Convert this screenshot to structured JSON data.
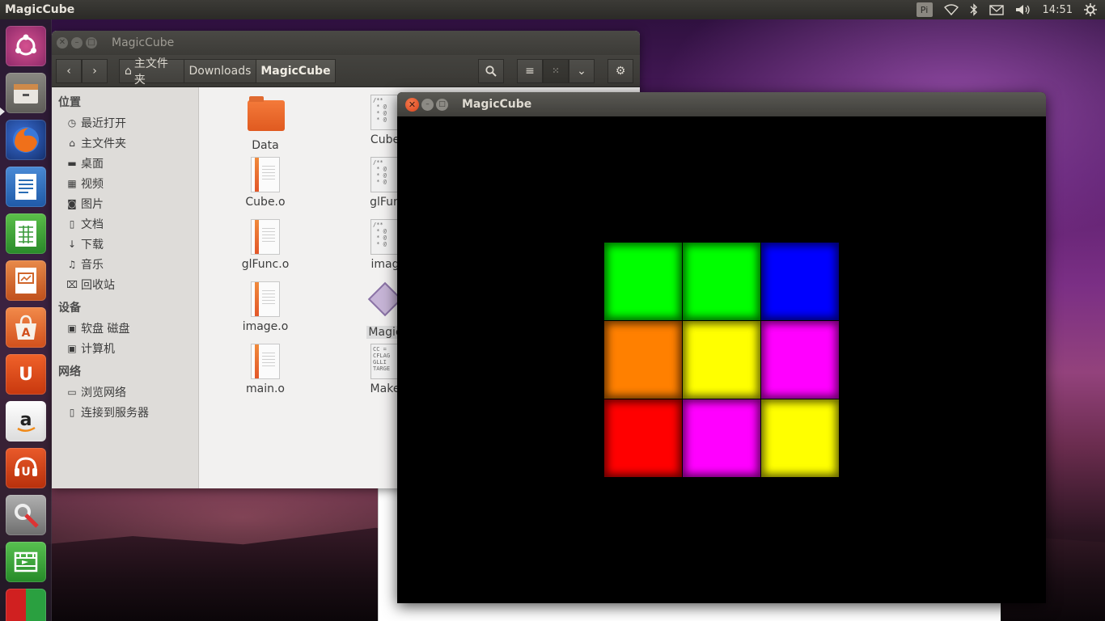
{
  "top_panel": {
    "app_title": "MagicCube",
    "keyboard_indicator": "Pi",
    "clock": "14:51"
  },
  "launcher": {
    "items": [
      {
        "name": "ubuntu-dash",
        "color": "#c9408a"
      },
      {
        "name": "files",
        "color": "#6a6964"
      },
      {
        "name": "firefox",
        "color": "#e66000"
      },
      {
        "name": "libreoffice-writer",
        "color": "#2a6db5"
      },
      {
        "name": "libreoffice-calc",
        "color": "#3a9a3a"
      },
      {
        "name": "libreoffice-impress",
        "color": "#d0652a"
      },
      {
        "name": "software-center",
        "color": "#e0662e"
      },
      {
        "name": "ubuntu-one",
        "color": "#e04d1f"
      },
      {
        "name": "amazon",
        "color": "#f2f2f2"
      },
      {
        "name": "ubuntu-one-music",
        "color": "#d9441c"
      },
      {
        "name": "system-settings",
        "color": "#9a9a9a"
      },
      {
        "name": "video-editor",
        "color": "#3aa640"
      },
      {
        "name": "workspace-switcher",
        "color": "#d02020"
      }
    ]
  },
  "file_manager": {
    "window_title": "MagicCube",
    "breadcrumbs": [
      "主文件夹",
      "Downloads",
      "MagicCube"
    ],
    "sidebar": {
      "sections": [
        {
          "heading": "位置",
          "items": [
            "最近打开",
            "主文件夹",
            "桌面",
            "视频",
            "图片",
            "文档",
            "下载",
            "音乐",
            "回收站"
          ]
        },
        {
          "heading": "设备",
          "items": [
            "软盘 磁盘",
            "计算机"
          ]
        },
        {
          "heading": "网络",
          "items": [
            "浏览网络",
            "连接到服务器"
          ]
        }
      ]
    },
    "files": [
      {
        "label": "Data",
        "kind": "folder"
      },
      {
        "label": "Cube.o",
        "kind": "object"
      },
      {
        "label": "glFunc.o",
        "kind": "object"
      },
      {
        "label": "image.o",
        "kind": "object"
      },
      {
        "label": "main.o",
        "kind": "object"
      },
      {
        "label": "Cube",
        "kind": "code"
      },
      {
        "label": "glFun",
        "kind": "code"
      },
      {
        "label": "imag",
        "kind": "code"
      },
      {
        "label": "Magic",
        "kind": "executable"
      },
      {
        "label": "Make",
        "kind": "makefile"
      }
    ],
    "code_preview": "/**\n * @\n * @\n * @",
    "makefile_preview": "CC =\nCFLAG\nGLLI\nTARGE"
  },
  "gl_window": {
    "window_title": "MagicCube",
    "cube_face": [
      [
        "#00ff00",
        "#00ff00",
        "#0000ff"
      ],
      [
        "#ff8000",
        "#ffff00",
        "#ff00ff"
      ],
      [
        "#ff0000",
        "#ff00ff",
        "#ffff00"
      ]
    ]
  }
}
